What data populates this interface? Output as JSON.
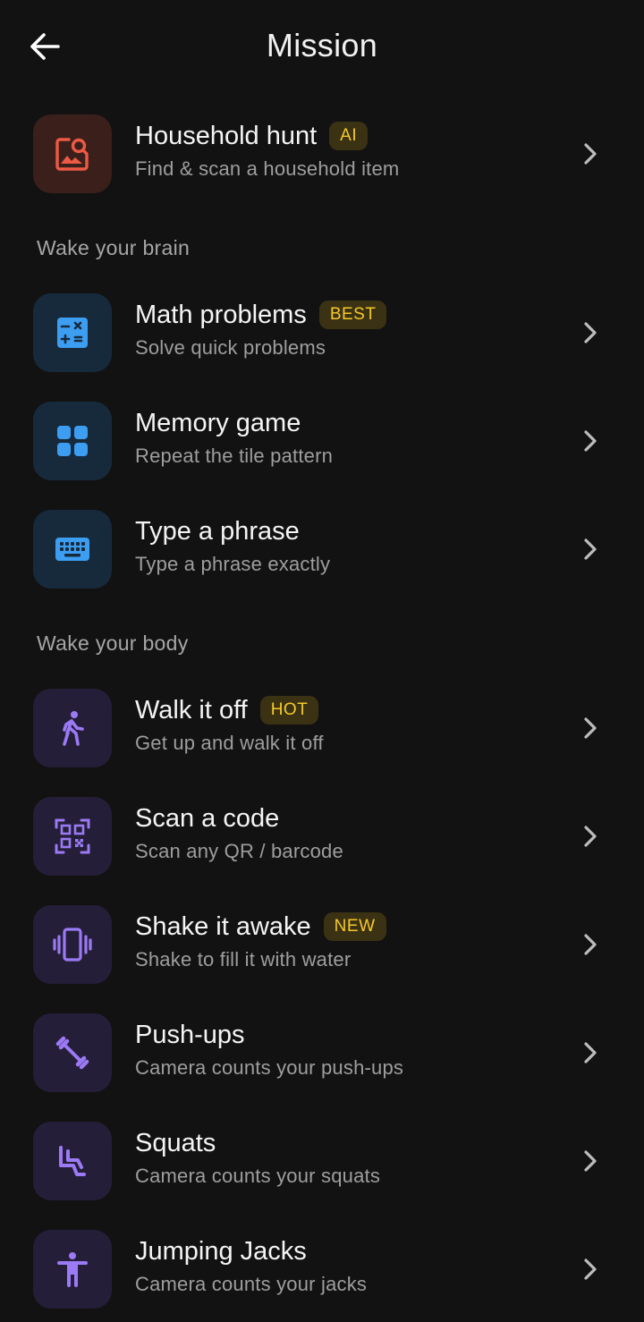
{
  "header": {
    "title": "Mission",
    "back_icon": "arrow-left-icon"
  },
  "featured": {
    "title": "Household hunt",
    "badge": "AI",
    "subtitle": "Find & scan a household item",
    "icon": "photo-search-icon"
  },
  "sections": {
    "brain": "Wake your brain",
    "body": "Wake your body"
  },
  "brain_items": [
    {
      "title": "Math problems",
      "badge": "BEST",
      "subtitle": "Solve quick problems",
      "icon": "calculator-icon"
    },
    {
      "title": "Memory game",
      "subtitle": "Repeat the tile pattern",
      "icon": "grid-tiles-icon"
    },
    {
      "title": "Type a phrase",
      "subtitle": "Type a phrase exactly",
      "icon": "keyboard-icon"
    }
  ],
  "body_items": [
    {
      "title": "Walk it off",
      "badge": "HOT",
      "subtitle": "Get up and walk it off",
      "icon": "walking-person-icon"
    },
    {
      "title": "Scan a code",
      "subtitle": "Scan any QR / barcode",
      "icon": "qr-code-icon"
    },
    {
      "title": "Shake it awake",
      "badge": "NEW",
      "subtitle": "Shake to fill it with water",
      "icon": "phone-vibrate-icon"
    },
    {
      "title": "Push-ups",
      "subtitle": "Camera counts your push-ups",
      "icon": "dumbbell-icon"
    },
    {
      "title": "Squats",
      "subtitle": "Camera counts your squats",
      "icon": "squat-icon"
    },
    {
      "title": "Jumping Jacks",
      "subtitle": "Camera counts your jacks",
      "icon": "jumping-jack-icon"
    }
  ],
  "colors": {
    "background": "#121212",
    "badge_text": "#f5c92a",
    "badge_bg": "#3b3214",
    "featured_icon": "#ec5a45",
    "brain_icon": "#3d9df0",
    "body_icon": "#9b7af5"
  }
}
